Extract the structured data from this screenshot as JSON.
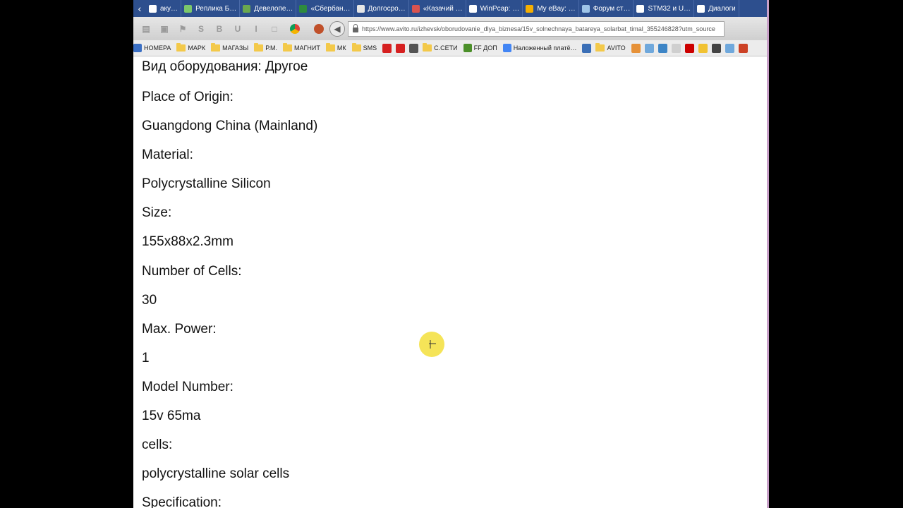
{
  "tabs": [
    {
      "label": "аку…",
      "icon": "page-icon",
      "color": "#ffffff"
    },
    {
      "label": "Реплика Б…",
      "icon": "bulb-icon",
      "color": "#7cc86b"
    },
    {
      "label": "Девелопе…",
      "icon": "android-icon",
      "color": "#6aa84f"
    },
    {
      "label": "«Сбербан…",
      "icon": "sberbank-icon",
      "color": "#2e8b3e"
    },
    {
      "label": "Долгосро…",
      "icon": "doc-icon",
      "color": "#e6e6e6"
    },
    {
      "label": "«Казачий …",
      "icon": "opera-icon",
      "color": "#d9534f"
    },
    {
      "label": "WinPcap: …",
      "icon": "winpcap-icon",
      "color": "#ffffff"
    },
    {
      "label": "My eBay: …",
      "icon": "ebay-icon",
      "color": "#f5af02"
    },
    {
      "label": "Форум ст…",
      "icon": "forum-icon",
      "color": "#9fc5e8"
    },
    {
      "label": "STM32 и U…",
      "icon": "h-icon",
      "color": "#ffffff"
    },
    {
      "label": "Диалоги",
      "icon": "chat-icon",
      "color": "#ffffff"
    }
  ],
  "address_bar": {
    "url": "https://www.avito.ru/izhevsk/oborudovanie_dlya_biznesa/15v_solnechnaya_batareya_solarbat_timal_355246828?utm_source"
  },
  "bookmarks": [
    {
      "label": "НОМЕРА",
      "type": "page",
      "color": "#3a6fc4"
    },
    {
      "label": "МАРК",
      "type": "folder"
    },
    {
      "label": "МАГАЗЫ",
      "type": "folder"
    },
    {
      "label": "Р.М.",
      "type": "folder"
    },
    {
      "label": "МАГНИТ",
      "type": "folder"
    },
    {
      "label": "МК",
      "type": "folder"
    },
    {
      "label": "SMS",
      "type": "folder"
    },
    {
      "label": "",
      "type": "icon",
      "color": "#d62020"
    },
    {
      "label": "",
      "type": "icon",
      "color": "#d62020"
    },
    {
      "label": "",
      "type": "icon",
      "color": "#555555"
    },
    {
      "label": "С.СЕТИ",
      "type": "folder"
    },
    {
      "label": "FF ДОП",
      "type": "page",
      "color": "#4b8f29"
    },
    {
      "label": "Наложенный платё…",
      "type": "page",
      "color": "#4285f4"
    },
    {
      "label": "",
      "type": "icon",
      "color": "#3b6fb6"
    },
    {
      "label": "AVITO",
      "type": "folder"
    },
    {
      "label": "",
      "type": "icon",
      "color": "#e69138"
    },
    {
      "label": "",
      "type": "icon",
      "color": "#6fa8dc"
    },
    {
      "label": "",
      "type": "icon",
      "color": "#3d85c6"
    },
    {
      "label": "",
      "type": "icon",
      "color": "#cfcfcf"
    },
    {
      "label": "",
      "type": "icon",
      "color": "#cc0000"
    },
    {
      "label": "",
      "type": "icon",
      "color": "#f1c232"
    },
    {
      "label": "",
      "type": "icon",
      "color": "#444444"
    },
    {
      "label": "",
      "type": "icon",
      "color": "#6fa8dc"
    },
    {
      "label": "",
      "type": "icon",
      "color": "#cc4125"
    }
  ],
  "content": {
    "lines": [
      "Вид оборудования: Другое",
      "Place of Origin:",
      "Guangdong China (Mainland)",
      "Material:",
      "Polycrystalline Silicon",
      "Size:",
      "155x88x2.3mm",
      "Number of Cells:",
      "30",
      "Max. Power:",
      "1",
      "Model Number:",
      "15v 65ma",
      "cells:",
      "polycrystalline solar cells",
      "Specification:"
    ]
  }
}
